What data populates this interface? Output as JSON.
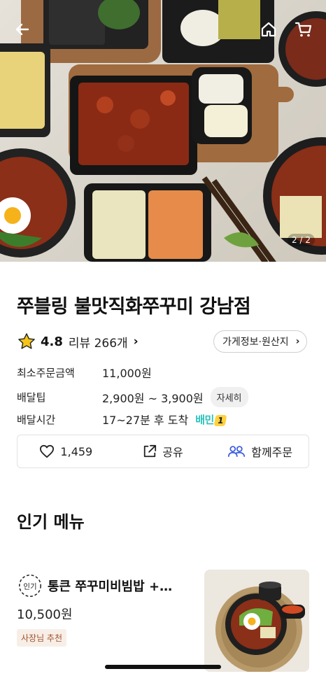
{
  "hero": {
    "page_counter": "2 / 2",
    "icons": {
      "back": "back-arrow-icon",
      "home": "home-icon",
      "cart": "cart-icon"
    }
  },
  "store": {
    "name": "쭈블링 불맛직화쭈꾸미 강남점",
    "rating": "4.8",
    "reviews": "리뷰 266개",
    "info_button": "가게정보·원산지",
    "details": {
      "min_order_label": "최소주문금액",
      "min_order_value": "11,000원",
      "delivery_tip_label": "배달팁",
      "delivery_tip_value": "2,900원 ~ 3,900원",
      "delivery_tip_more": "자세히",
      "delivery_time_label": "배달시간",
      "delivery_time_value": "17~27분 후 도착",
      "baemin_badge": "배민",
      "baemin_badge_num": "1"
    },
    "actions": {
      "like_count": "1,459",
      "share": "공유",
      "group_order": "함께주문"
    }
  },
  "popular": {
    "title": "인기 메뉴",
    "items": [
      {
        "badge": "인기",
        "name": "통큰 쭈꾸미비빔밥 +…",
        "price": "10,500원",
        "tag": "사장님 추천"
      }
    ]
  },
  "colors": {
    "accent_mint": "#2ac1bc",
    "star": "#f5c518",
    "tag_text": "#a0522d"
  }
}
